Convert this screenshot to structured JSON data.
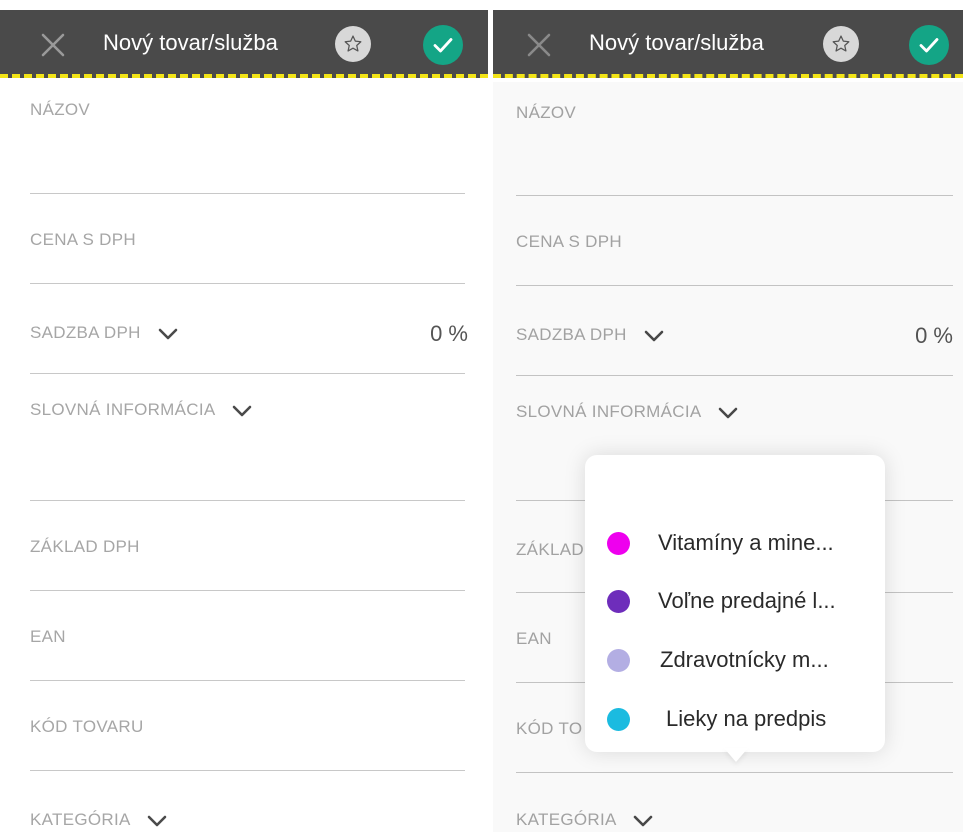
{
  "left": {
    "header": {
      "title": "Nový tovar/služba",
      "close_icon": "close-icon",
      "favorite_icon": "star-icon",
      "confirm_icon": "check-icon"
    },
    "fields": {
      "name_label": "NÁZOV",
      "price_label": "CENA S DPH",
      "vat_rate_label": "SADZBA DPH",
      "vat_rate_value": "0 %",
      "verbal_info_label": "SLOVNÁ INFORMÁCIA",
      "vat_base_label": "ZÁKLAD DPH",
      "ean_label": "EAN",
      "product_code_label": "KÓD TOVARU",
      "category_label": "KATEGÓRIA"
    }
  },
  "right": {
    "header": {
      "title": "Nový tovar/služba",
      "close_icon": "close-icon",
      "favorite_icon": "star-icon",
      "confirm_icon": "check-icon"
    },
    "fields": {
      "name_label": "NÁZOV",
      "price_label": "CENA S DPH",
      "vat_rate_label": "SADZBA DPH",
      "vat_rate_value": "0 %",
      "verbal_info_label": "SLOVNÁ INFORMÁCIA",
      "vat_base_label_visible": "ZÁKLAD",
      "ean_label": "EAN",
      "product_code_label_visible": "KÓD TO",
      "category_label": "KATEGÓRIA"
    },
    "category_popover": {
      "options": [
        {
          "label": "Vitamíny a mine...",
          "color": "#ee00ee"
        },
        {
          "label": "Voľne predajné l...",
          "color": "#6e2dbb"
        },
        {
          "label": "Zdravotnícky m...",
          "color": "#b3aee3"
        },
        {
          "label": "Lieky na predpis",
          "color": "#1bbbe0"
        }
      ]
    }
  },
  "colors": {
    "header_bg": "#4a4a4a",
    "header_stripe": "#f2e418",
    "confirm_green": "#14a586",
    "label_gray": "#a6a6a6"
  }
}
